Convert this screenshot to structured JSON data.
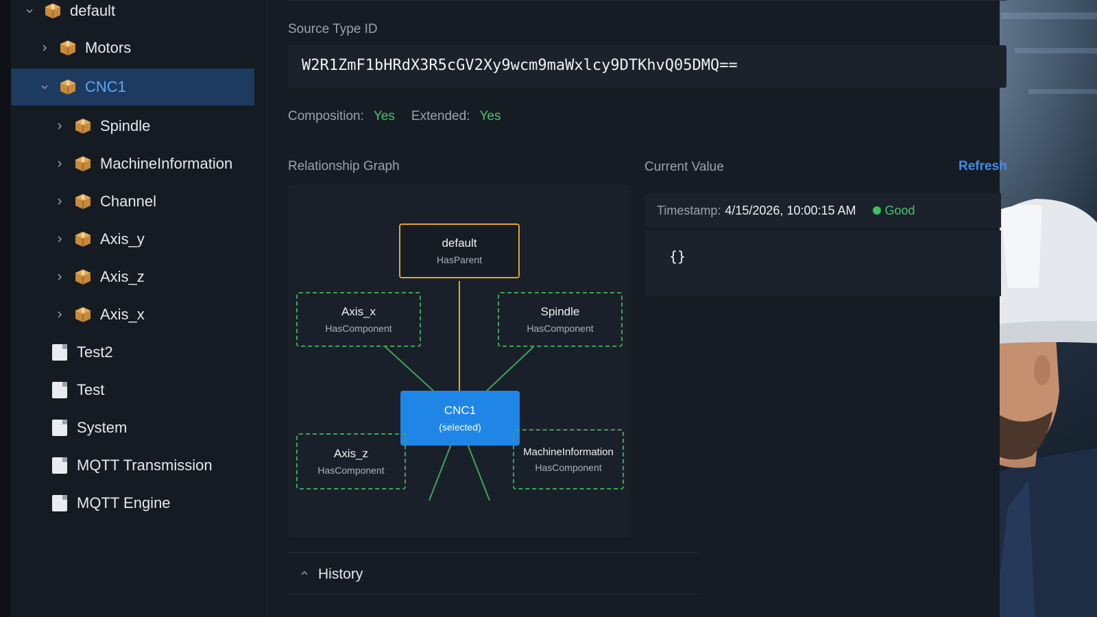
{
  "tree": {
    "items": [
      {
        "label": "default",
        "icon": "package-icon",
        "expanded": true
      },
      {
        "label": "Motors",
        "icon": "package-icon",
        "expanded": false
      },
      {
        "label": "CNC1",
        "icon": "package-icon",
        "expanded": true,
        "selected": true
      },
      {
        "label": "Spindle",
        "icon": "package-icon",
        "expanded": false
      },
      {
        "label": "MachineInformation",
        "icon": "package-icon",
        "expanded": false
      },
      {
        "label": "Channel",
        "icon": "package-icon",
        "expanded": false
      },
      {
        "label": "Axis_y",
        "icon": "package-icon",
        "expanded": false
      },
      {
        "label": "Axis_z",
        "icon": "package-icon",
        "expanded": false
      },
      {
        "label": "Axis_x",
        "icon": "package-icon",
        "expanded": false
      },
      {
        "label": "Test2",
        "icon": "page-icon"
      },
      {
        "label": "Test",
        "icon": "page-icon"
      },
      {
        "label": "System",
        "icon": "page-icon"
      },
      {
        "label": "MQTT Transmission",
        "icon": "page-icon"
      },
      {
        "label": "MQTT Engine",
        "icon": "page-icon"
      }
    ]
  },
  "details": {
    "source_type_label": "Source Type ID",
    "source_type_value": "W2R1ZmF1bHRdX3R5cGV2Xy9wcm9maWxlcy9DTKhvQ05DMQ==",
    "composition_label": "Composition:",
    "composition_value": "Yes",
    "extended_label": "Extended:",
    "extended_value": "Yes"
  },
  "graph": {
    "label": "Relationship Graph",
    "nodes": {
      "parent": {
        "title": "default",
        "sub": "HasParent"
      },
      "axis_x": {
        "title": "Axis_x",
        "sub": "HasComponent"
      },
      "spindle": {
        "title": "Spindle",
        "sub": "HasComponent"
      },
      "selected": {
        "title": "CNC1",
        "sub": "(selected)"
      },
      "axis_z": {
        "title": "Axis_z",
        "sub": "HasComponent"
      },
      "machine_info": {
        "title": "MachineInformation",
        "sub": "HasComponent"
      }
    }
  },
  "current_value": {
    "label": "Current Value",
    "refresh_label": "Refresh",
    "timestamp_label": "Timestamp:",
    "timestamp_value": "4/15/2026, 10:00:15 AM",
    "status": "Good",
    "value": "{}"
  },
  "sections": {
    "history": "History"
  },
  "colors": {
    "selected_row": "#1d3a5f",
    "accent_blue": "#1f86e8",
    "good_green": "#4cc36b",
    "parent_orange": "#e3a52a"
  }
}
